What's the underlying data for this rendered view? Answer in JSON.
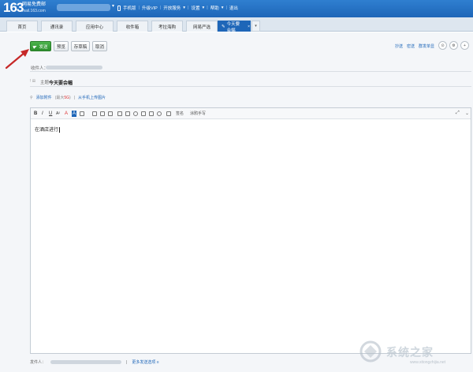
{
  "header": {
    "logo_number": "163",
    "logo_title": "网易免费邮",
    "logo_domain": "mail.163.com",
    "caret": "▾",
    "nav": [
      "手机版",
      "升级VIP",
      "开放服务",
      "设置",
      "帮助",
      "退出"
    ],
    "nav_carets": [
      "",
      "",
      "▾",
      "▾",
      "▾",
      ""
    ]
  },
  "tabs": [
    {
      "label": "首页"
    },
    {
      "label": "通讯录"
    },
    {
      "label": "应用中心"
    },
    {
      "label": "收件箱"
    },
    {
      "label": "考拉海购"
    },
    {
      "label": "网易严选"
    },
    {
      "label": "今天要会幅",
      "close": "×"
    }
  ],
  "tab_dropdown": "▾",
  "toolbar": {
    "send_label": "发送",
    "preview_label": "预览",
    "draft_label": "存草稿",
    "cancel_label": "取消",
    "right_links": [
      "抄送",
      "密送",
      "群发单显"
    ],
    "circle_icons": [
      "⊙",
      "⚙",
      "+"
    ]
  },
  "fields": {
    "recipient_label": "收件人：",
    "subject_label": "主题：",
    "subject_icons": "!  ⊞",
    "subject_value": "今天要会幅"
  },
  "attachments": {
    "add_attachment": "添加附件",
    "size_limit": "(最大5G)",
    "size_prefix": "(最大",
    "size_value": "5G",
    "size_suffix": ")",
    "sep": "|",
    "upload_phone": "从手机上传图片"
  },
  "editor": {
    "tools": [
      "B",
      "I",
      "U",
      "A²",
      "A",
      "A"
    ],
    "signature_label": "签名",
    "handwrite_label": "涂鸦手写",
    "body_text": "在酒店进行",
    "expand": "⤢",
    "more": "⌄"
  },
  "footer": {
    "sender_label": "发件人：",
    "sep": "|",
    "more_options": "更多发送选项 ≡"
  },
  "watermark": {
    "text": "系统之家",
    "url": "www.xitongzhijia.net"
  },
  "colors": {
    "header_blue": "#1e66b8",
    "send_green": "#2d8f2d",
    "annotation_red": "#c62828"
  }
}
